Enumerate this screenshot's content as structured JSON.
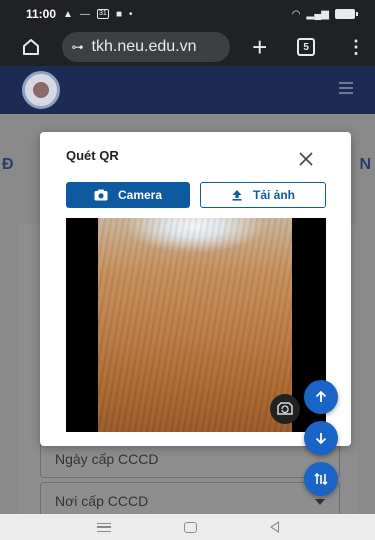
{
  "status_bar": {
    "time": "11:00",
    "calendar_day": "31"
  },
  "browser": {
    "url": "tkh.neu.edu.vn",
    "tab_count": "5"
  },
  "page": {
    "edge_letter_left": "Đ",
    "edge_letter_right": "N",
    "fields": [
      {
        "placeholder": "Ngày cấp CCCD"
      },
      {
        "placeholder": "Nơi cấp CCCD"
      }
    ]
  },
  "modal": {
    "title": "Quét QR",
    "camera_label": "Camera",
    "upload_label": "Tải ảnh"
  },
  "colors": {
    "primary": "#0d5aa0",
    "fab": "#1a64c8",
    "header": "#1d2b52"
  },
  "icons": [
    "home-icon",
    "tune-icon",
    "plus-icon",
    "tabs-icon",
    "more-vert-icon",
    "hamburger-icon",
    "close-icon",
    "camera-icon",
    "upload-icon",
    "switch-camera-icon",
    "arrow-up-icon",
    "arrow-down-icon",
    "sort-icon"
  ]
}
